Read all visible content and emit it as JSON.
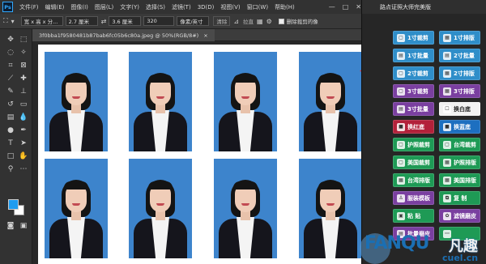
{
  "app": {
    "logo": "Ps"
  },
  "menu": [
    "文件(F)",
    "编辑(E)",
    "图像(I)",
    "图层(L)",
    "文字(Y)",
    "选择(S)",
    "滤镜(T)",
    "3D(D)",
    "视图(V)",
    "窗口(W)",
    "帮助(H)"
  ],
  "options": {
    "ratio": "宽 x 高 x 分...",
    "width": "2.7 厘米",
    "height": "3.6 厘米",
    "resolution": "320",
    "unit": "像素/英寸",
    "clear": "清除",
    "straighten": "拉直",
    "delete_cropped": "删除裁剪的像"
  },
  "document": {
    "tab_title": "3f0bba1f9580481b87bab6fc05b6c80a.jpeg @ 50%(RGB/8#)",
    "close": "×"
  },
  "panel": {
    "title": "路点证照大师完美版",
    "buttons": [
      {
        "label": "1寸裁剪",
        "icon": "crop",
        "color": "#2f8ec9"
      },
      {
        "label": "1寸排版",
        "icon": "grid",
        "color": "#2f8ec9"
      },
      {
        "label": "1寸批量",
        "icon": "batch",
        "color": "#2f8ec9"
      },
      {
        "label": "2寸批量",
        "icon": "batch",
        "color": "#2f8ec9"
      },
      {
        "label": "2寸裁剪",
        "icon": "crop",
        "color": "#2f8ec9"
      },
      {
        "label": "2寸排版",
        "icon": "grid",
        "color": "#2f8ec9"
      },
      {
        "label": "3寸裁剪",
        "icon": "crop",
        "color": "#7a3fa0"
      },
      {
        "label": "3寸排版",
        "icon": "grid",
        "color": "#7a3fa0"
      },
      {
        "label": "3寸批量",
        "icon": "batch",
        "color": "#7a3fa0"
      },
      {
        "label": "换白底",
        "icon": "white",
        "color": "#f2f2f2"
      },
      {
        "label": "换红底",
        "icon": "red",
        "color": "#b3213a"
      },
      {
        "label": "换蓝底",
        "icon": "blue",
        "color": "#1d6fc0"
      },
      {
        "label": "护照裁剪",
        "icon": "crop",
        "color": "#1e9a55"
      },
      {
        "label": "台湾裁剪",
        "icon": "crop",
        "color": "#1e9a55"
      },
      {
        "label": "美国裁剪",
        "icon": "crop",
        "color": "#1e9a55"
      },
      {
        "label": "护照排版",
        "icon": "grid",
        "color": "#1e9a55"
      },
      {
        "label": "台湾排版",
        "icon": "grid",
        "color": "#1e9a55"
      },
      {
        "label": "美国排版",
        "icon": "grid",
        "color": "#1e9a55"
      },
      {
        "label": "服装模板",
        "icon": "shirt",
        "color": "#7a3fa0"
      },
      {
        "label": "复 制",
        "icon": "copy",
        "color": "#1e9a55"
      },
      {
        "label": "粘 贴",
        "icon": "paste",
        "color": "#1e9a55"
      },
      {
        "label": "滤镜磨皮",
        "icon": "filter",
        "color": "#7a3fa0"
      },
      {
        "label": "批量磨皮",
        "icon": "batch",
        "color": "#7a3fa0"
      },
      {
        "label": "",
        "icon": "more",
        "color": "#1e9a55"
      }
    ]
  },
  "watermark": {
    "brand": "FANQU",
    "cn": "凡趣",
    "sub": "cuel.cn"
  }
}
